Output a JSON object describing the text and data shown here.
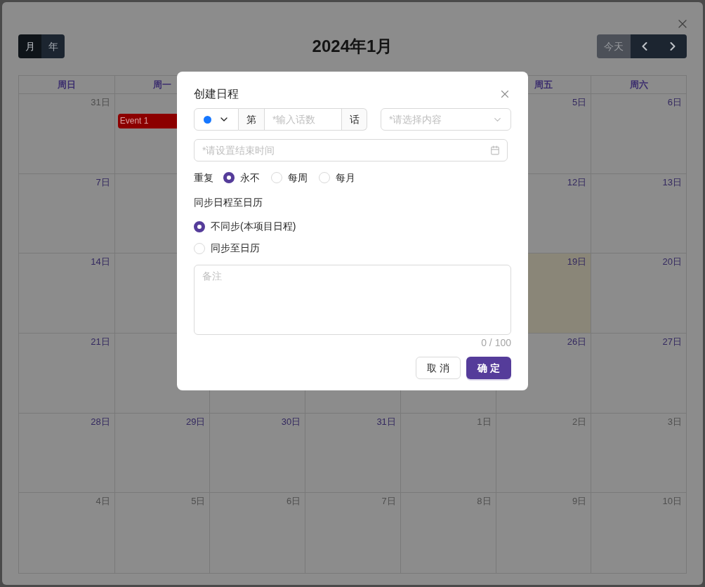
{
  "calendar": {
    "view_toggle": [
      {
        "label": "月",
        "selected": true
      },
      {
        "label": "年",
        "selected": false
      }
    ],
    "title": "2024年1月",
    "today_button": "今天",
    "weekdays": {
      "sun": "周日",
      "mon": "周一",
      "fri": "周五",
      "sat": "周六"
    },
    "weeks": [
      {
        "sun": {
          "day": "31日",
          "outside_month": true,
          "today": false
        },
        "mon": {
          "today": false,
          "events": [
            {
              "title": "Event 1"
            }
          ]
        },
        "fri": {
          "day": "5日",
          "outside_month": false,
          "today": false
        },
        "sat": {
          "day": "6日",
          "outside_month": false,
          "today": false
        }
      },
      {
        "sun": {
          "day": "7日",
          "outside_month": false,
          "today": false
        },
        "mon": {
          "today": false
        },
        "fri": {
          "day": "12日",
          "outside_month": false,
          "today": false
        },
        "sat": {
          "day": "13日",
          "outside_month": false,
          "today": false
        }
      },
      {
        "sun": {
          "day": "14日",
          "outside_month": false,
          "today": false
        },
        "mon": {
          "today": false
        },
        "fri": {
          "day": "19日",
          "outside_month": false,
          "today": true
        },
        "sat": {
          "day": "20日",
          "outside_month": false,
          "today": false
        }
      },
      {
        "sun": {
          "day": "21日",
          "outside_month": false,
          "today": false
        },
        "mon": {
          "today": false
        },
        "tue": {
          "today": false
        },
        "wed": {
          "today": false
        },
        "thu": {
          "today": false
        },
        "fri": {
          "day": "26日",
          "outside_month": false,
          "today": false
        },
        "sat": {
          "day": "27日",
          "outside_month": false,
          "today": false
        }
      },
      {
        "sun": {
          "day": "28日",
          "outside_month": false,
          "today": false
        },
        "mon": {
          "day": "29日",
          "outside_month": false,
          "today": false
        },
        "tue": {
          "day": "30日",
          "outside_month": false,
          "today": false
        },
        "wed": {
          "day": "31日",
          "outside_month": false,
          "today": false
        },
        "thu": {
          "day": "1日",
          "outside_month": true,
          "today": false
        },
        "fri": {
          "day": "2日",
          "outside_month": true,
          "today": false
        },
        "sat": {
          "day": "3日",
          "outside_month": true,
          "today": false
        }
      },
      {
        "sun": {
          "day": "4日",
          "outside_month": true,
          "today": false
        },
        "mon": {
          "day": "5日",
          "outside_month": true,
          "today": false
        },
        "tue": {
          "day": "6日",
          "outside_month": true,
          "today": false
        },
        "wed": {
          "day": "7日",
          "outside_month": true,
          "today": false
        },
        "thu": {
          "day": "8日",
          "outside_month": true,
          "today": false
        },
        "fri": {
          "day": "9日",
          "outside_month": true,
          "today": false
        },
        "sat": {
          "day": "10日",
          "outside_month": true,
          "today": false
        }
      }
    ]
  },
  "dialog": {
    "title": "创建日程",
    "color_select": {
      "color": "#1677ff"
    },
    "episode_prefix": "第",
    "episode_placeholder": "*输入话数",
    "episode_suffix": "话",
    "content_select": {
      "placeholder": "*请选择内容"
    },
    "end_time": {
      "placeholder": "*请设置结束时间"
    },
    "repeat": {
      "label": "重复",
      "options": [
        {
          "label": "永不",
          "selected": true
        },
        {
          "label": "每周",
          "selected": false
        },
        {
          "label": "每月",
          "selected": false
        }
      ]
    },
    "sync": {
      "label": "同步日程至日历",
      "options": [
        {
          "label": "不同步(本项目日程)",
          "selected": true
        },
        {
          "label": "同步至日历",
          "selected": false
        }
      ]
    },
    "notes": {
      "placeholder": "备注",
      "counter": "0 / 100"
    },
    "buttons": [
      {
        "label": "取 消",
        "kind": "secondary"
      },
      {
        "label": "确 定",
        "kind": "primary"
      }
    ]
  }
}
